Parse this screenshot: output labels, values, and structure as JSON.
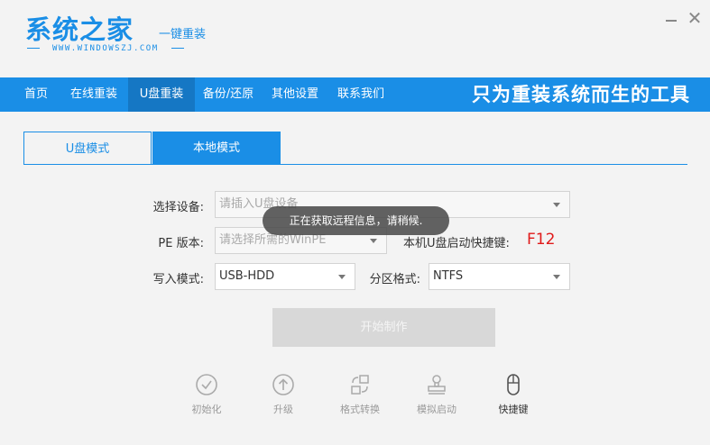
{
  "app": {
    "title": "系统之家",
    "subtitle": "一键重装",
    "url": "WWW.WINDOWSZJ.COM",
    "slogan": "只为重装系统而生的工具"
  },
  "nav": {
    "items": [
      {
        "label": "首页",
        "active": false
      },
      {
        "label": "在线重装",
        "active": false
      },
      {
        "label": "U盘重装",
        "active": true
      },
      {
        "label": "备份/还原",
        "active": false
      },
      {
        "label": "其他设置",
        "active": false
      },
      {
        "label": "联系我们",
        "active": false
      }
    ]
  },
  "tabs": {
    "usb": "U盘模式",
    "local": "本地模式",
    "active": "usb"
  },
  "form": {
    "device_label": "选择设备:",
    "device_placeholder": "请插入U盘设备",
    "pe_label": "PE 版本:",
    "pe_placeholder": "请选择所需的WinPE",
    "write_label": "写入模式:",
    "write_value": "USB-HDD",
    "partition_label": "分区格式:",
    "partition_value": "NTFS",
    "hotkey_label": "本机U盘启动快捷键:",
    "hotkey_value": "F12",
    "start_button": "开始制作"
  },
  "toast": "正在获取远程信息，请稍候.",
  "tools": [
    {
      "label": "初始化",
      "icon": "check-circle-icon"
    },
    {
      "label": "升级",
      "icon": "arrow-up-circle-icon"
    },
    {
      "label": "格式转换",
      "icon": "convert-icon"
    },
    {
      "label": "模拟启动",
      "icon": "stamp-icon"
    },
    {
      "label": "快捷键",
      "icon": "mouse-icon",
      "active": true
    }
  ],
  "colors": {
    "accent": "#1a8ee6",
    "nav_active": "#1577c4",
    "hotkey": "#e01a1a",
    "background": "#f3f3f3"
  }
}
